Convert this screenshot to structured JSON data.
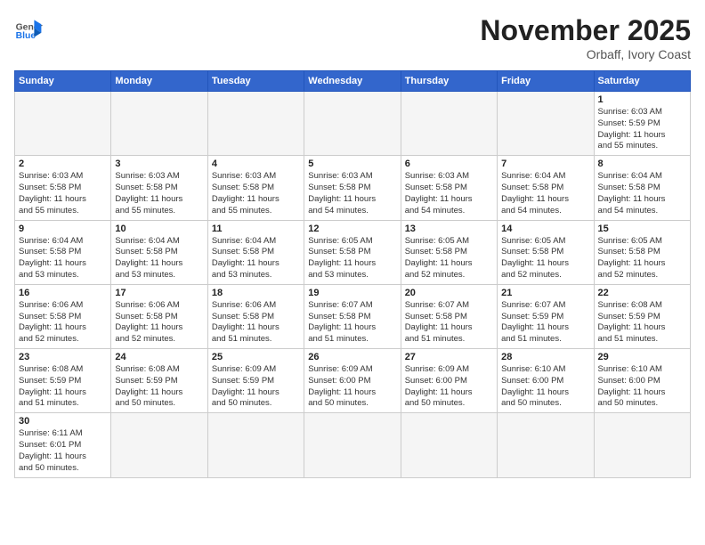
{
  "header": {
    "logo_general": "General",
    "logo_blue": "Blue",
    "month": "November 2025",
    "location": "Orbaff, Ivory Coast"
  },
  "days_of_week": [
    "Sunday",
    "Monday",
    "Tuesday",
    "Wednesday",
    "Thursday",
    "Friday",
    "Saturday"
  ],
  "weeks": [
    [
      {
        "day": "",
        "info": ""
      },
      {
        "day": "",
        "info": ""
      },
      {
        "day": "",
        "info": ""
      },
      {
        "day": "",
        "info": ""
      },
      {
        "day": "",
        "info": ""
      },
      {
        "day": "",
        "info": ""
      },
      {
        "day": "1",
        "info": "Sunrise: 6:03 AM\nSunset: 5:59 PM\nDaylight: 11 hours\nand 55 minutes."
      }
    ],
    [
      {
        "day": "2",
        "info": "Sunrise: 6:03 AM\nSunset: 5:58 PM\nDaylight: 11 hours\nand 55 minutes."
      },
      {
        "day": "3",
        "info": "Sunrise: 6:03 AM\nSunset: 5:58 PM\nDaylight: 11 hours\nand 55 minutes."
      },
      {
        "day": "4",
        "info": "Sunrise: 6:03 AM\nSunset: 5:58 PM\nDaylight: 11 hours\nand 55 minutes."
      },
      {
        "day": "5",
        "info": "Sunrise: 6:03 AM\nSunset: 5:58 PM\nDaylight: 11 hours\nand 54 minutes."
      },
      {
        "day": "6",
        "info": "Sunrise: 6:03 AM\nSunset: 5:58 PM\nDaylight: 11 hours\nand 54 minutes."
      },
      {
        "day": "7",
        "info": "Sunrise: 6:04 AM\nSunset: 5:58 PM\nDaylight: 11 hours\nand 54 minutes."
      },
      {
        "day": "8",
        "info": "Sunrise: 6:04 AM\nSunset: 5:58 PM\nDaylight: 11 hours\nand 54 minutes."
      }
    ],
    [
      {
        "day": "9",
        "info": "Sunrise: 6:04 AM\nSunset: 5:58 PM\nDaylight: 11 hours\nand 53 minutes."
      },
      {
        "day": "10",
        "info": "Sunrise: 6:04 AM\nSunset: 5:58 PM\nDaylight: 11 hours\nand 53 minutes."
      },
      {
        "day": "11",
        "info": "Sunrise: 6:04 AM\nSunset: 5:58 PM\nDaylight: 11 hours\nand 53 minutes."
      },
      {
        "day": "12",
        "info": "Sunrise: 6:05 AM\nSunset: 5:58 PM\nDaylight: 11 hours\nand 53 minutes."
      },
      {
        "day": "13",
        "info": "Sunrise: 6:05 AM\nSunset: 5:58 PM\nDaylight: 11 hours\nand 52 minutes."
      },
      {
        "day": "14",
        "info": "Sunrise: 6:05 AM\nSunset: 5:58 PM\nDaylight: 11 hours\nand 52 minutes."
      },
      {
        "day": "15",
        "info": "Sunrise: 6:05 AM\nSunset: 5:58 PM\nDaylight: 11 hours\nand 52 minutes."
      }
    ],
    [
      {
        "day": "16",
        "info": "Sunrise: 6:06 AM\nSunset: 5:58 PM\nDaylight: 11 hours\nand 52 minutes."
      },
      {
        "day": "17",
        "info": "Sunrise: 6:06 AM\nSunset: 5:58 PM\nDaylight: 11 hours\nand 52 minutes."
      },
      {
        "day": "18",
        "info": "Sunrise: 6:06 AM\nSunset: 5:58 PM\nDaylight: 11 hours\nand 51 minutes."
      },
      {
        "day": "19",
        "info": "Sunrise: 6:07 AM\nSunset: 5:58 PM\nDaylight: 11 hours\nand 51 minutes."
      },
      {
        "day": "20",
        "info": "Sunrise: 6:07 AM\nSunset: 5:58 PM\nDaylight: 11 hours\nand 51 minutes."
      },
      {
        "day": "21",
        "info": "Sunrise: 6:07 AM\nSunset: 5:59 PM\nDaylight: 11 hours\nand 51 minutes."
      },
      {
        "day": "22",
        "info": "Sunrise: 6:08 AM\nSunset: 5:59 PM\nDaylight: 11 hours\nand 51 minutes."
      }
    ],
    [
      {
        "day": "23",
        "info": "Sunrise: 6:08 AM\nSunset: 5:59 PM\nDaylight: 11 hours\nand 51 minutes."
      },
      {
        "day": "24",
        "info": "Sunrise: 6:08 AM\nSunset: 5:59 PM\nDaylight: 11 hours\nand 50 minutes."
      },
      {
        "day": "25",
        "info": "Sunrise: 6:09 AM\nSunset: 5:59 PM\nDaylight: 11 hours\nand 50 minutes."
      },
      {
        "day": "26",
        "info": "Sunrise: 6:09 AM\nSunset: 6:00 PM\nDaylight: 11 hours\nand 50 minutes."
      },
      {
        "day": "27",
        "info": "Sunrise: 6:09 AM\nSunset: 6:00 PM\nDaylight: 11 hours\nand 50 minutes."
      },
      {
        "day": "28",
        "info": "Sunrise: 6:10 AM\nSunset: 6:00 PM\nDaylight: 11 hours\nand 50 minutes."
      },
      {
        "day": "29",
        "info": "Sunrise: 6:10 AM\nSunset: 6:00 PM\nDaylight: 11 hours\nand 50 minutes."
      }
    ],
    [
      {
        "day": "30",
        "info": "Sunrise: 6:11 AM\nSunset: 6:01 PM\nDaylight: 11 hours\nand 50 minutes."
      },
      {
        "day": "",
        "info": ""
      },
      {
        "day": "",
        "info": ""
      },
      {
        "day": "",
        "info": ""
      },
      {
        "day": "",
        "info": ""
      },
      {
        "day": "",
        "info": ""
      },
      {
        "day": "",
        "info": ""
      }
    ]
  ]
}
